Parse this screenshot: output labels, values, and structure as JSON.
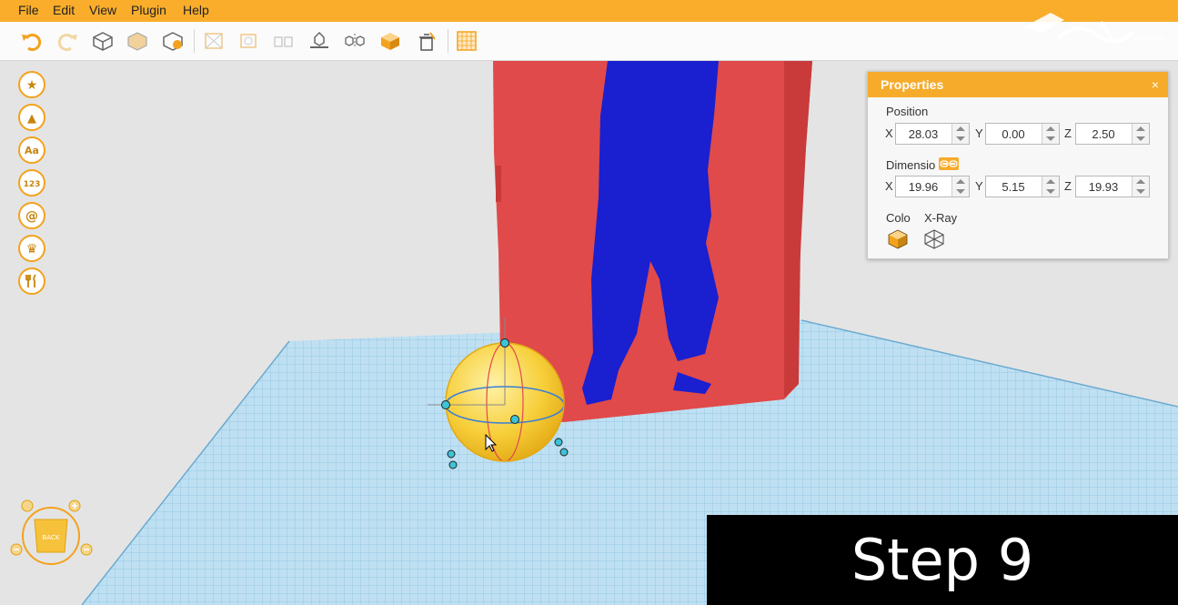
{
  "menu": {
    "items": [
      "File",
      "Edit",
      "View",
      "Plugin",
      "Help"
    ]
  },
  "toolbar": {
    "icons": [
      "undo-icon",
      "redo-icon",
      "cube-outline-icon",
      "cube-faded-icon",
      "cube-add-icon",
      "align-icon",
      "group-icon",
      "ungroup-icon",
      "lay-flat-icon",
      "mirror-icon",
      "cube-solid-icon",
      "delete-icon",
      "grid-icon"
    ]
  },
  "sidebar": {
    "items": [
      {
        "icon": "star-icon",
        "glyph": "★"
      },
      {
        "icon": "shapes-icon",
        "glyph": "▲"
      },
      {
        "icon": "text-icon",
        "glyph": "Aa"
      },
      {
        "icon": "numbers-icon",
        "glyph": "123"
      },
      {
        "icon": "at-icon",
        "glyph": "@"
      },
      {
        "icon": "crown-icon",
        "glyph": "♛"
      },
      {
        "icon": "utensils-icon",
        "glyph": "🍴"
      }
    ]
  },
  "properties": {
    "title": "Properties",
    "close": "×",
    "position_label": "Position",
    "position": {
      "x_label": "X",
      "x": "28.03",
      "y_label": "Y",
      "y": "0.00",
      "z_label": "Z",
      "z": "2.50"
    },
    "dimension_label": "Dimensio",
    "dimension": {
      "x_label": "X",
      "x": "19.96",
      "y_label": "Y",
      "y": "5.15",
      "z_label": "Z",
      "z": "19.93"
    },
    "color_label": "Colo",
    "xray_label": "X-Ray"
  },
  "view_nav": {
    "back_label": "BACK"
  },
  "overlay": {
    "step_text": "Step 9"
  },
  "colors": {
    "accent": "#f9ad2b",
    "part_red": "#e04a4a",
    "figure_blue": "#1a1fd0",
    "grid_blue": "#a8d4ec",
    "sphere_yellow": "#f7cf3a"
  }
}
